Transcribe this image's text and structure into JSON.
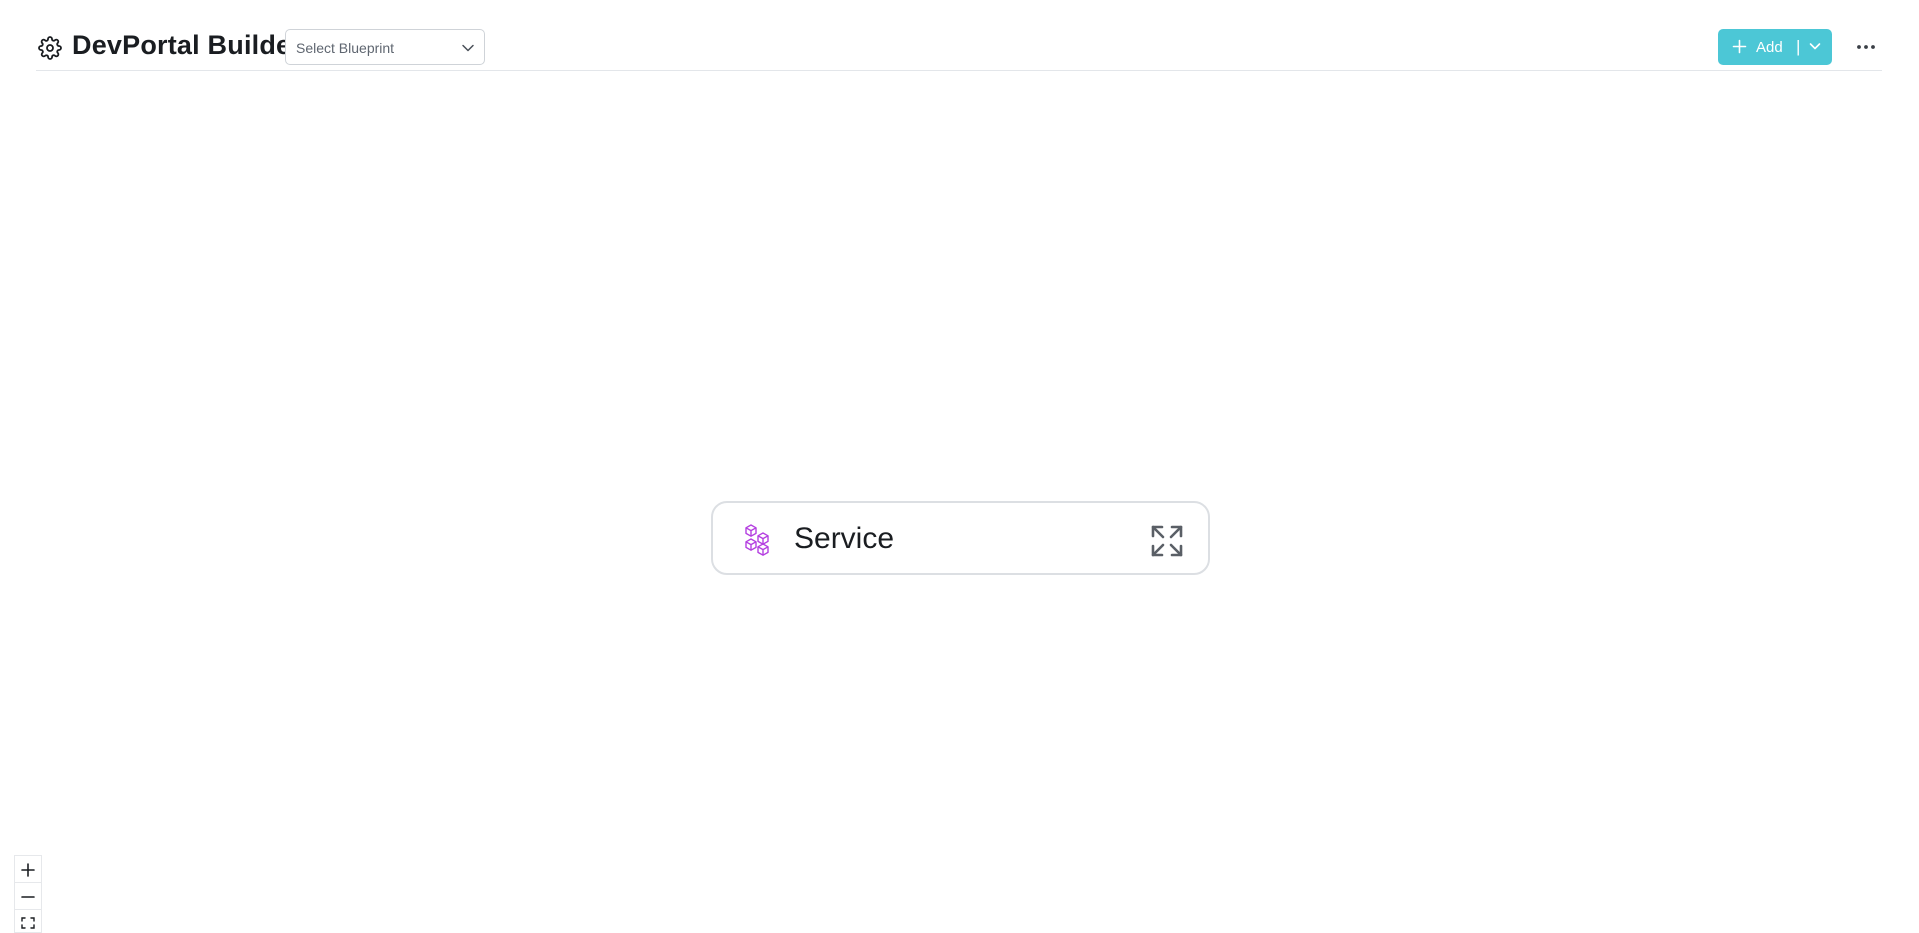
{
  "header": {
    "title": "DevPortal Builder",
    "settings_icon": "gear-icon",
    "blueprint_select": {
      "placeholder": "Select Blueprint",
      "icon": "chevron-down-icon"
    },
    "add_button": {
      "label": "Add",
      "separator": "|",
      "icon": "plus-icon",
      "dropdown_icon": "chevron-down-icon",
      "color": "#4cc7d6"
    },
    "more_icon": "more-horizontal-icon"
  },
  "canvas": {
    "node": {
      "label": "Service",
      "icon": "cubes-icon",
      "icon_color": "#b43fe0",
      "action_icon": "expand-icon"
    }
  },
  "zoom_controls": {
    "zoom_in": "+",
    "zoom_out": "−",
    "fit_icon": "fit-view-icon"
  }
}
